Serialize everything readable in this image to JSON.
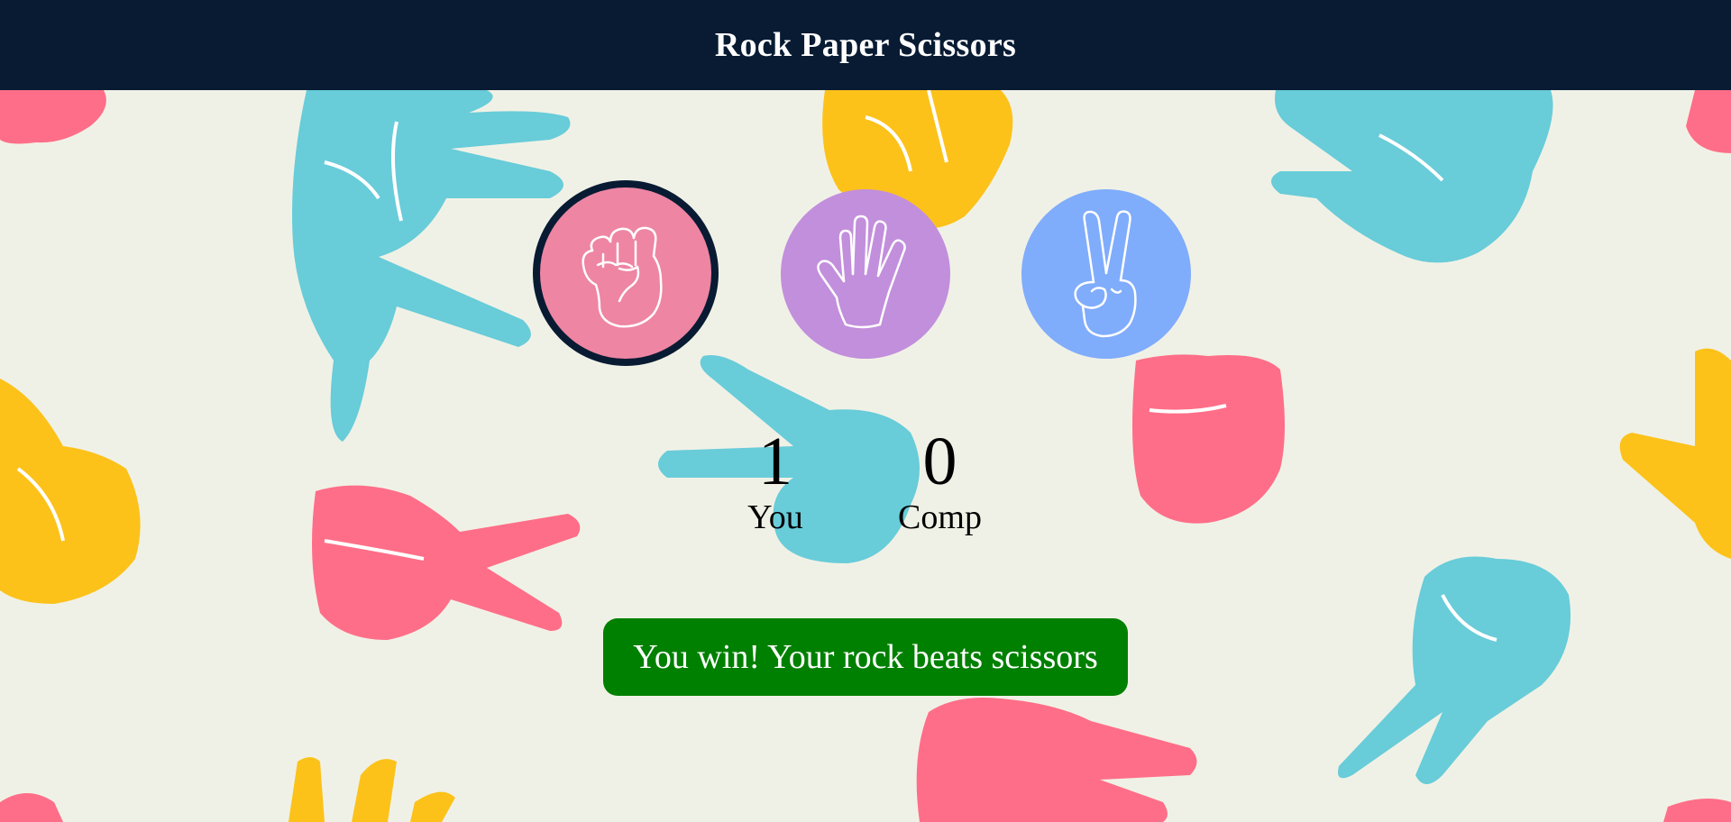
{
  "header": {
    "title": "Rock Paper Scissors"
  },
  "choices": [
    {
      "id": "rock",
      "icon": "fist-icon",
      "color": "#ee85a3",
      "selected": true
    },
    {
      "id": "paper",
      "icon": "open-hand-icon",
      "color": "#c28fdc",
      "selected": false
    },
    {
      "id": "scissors",
      "icon": "peace-hand-icon",
      "color": "#80acfc",
      "selected": false
    }
  ],
  "score": {
    "user_score": "1",
    "user_label": "You",
    "comp_score": "0",
    "comp_label": "Comp"
  },
  "message": {
    "text": "You win! Your rock beats scissors",
    "color": "#008000"
  },
  "colors": {
    "header_bg": "#081b33",
    "page_bg": "#f0f1e6",
    "selected_border": "#081b33"
  }
}
